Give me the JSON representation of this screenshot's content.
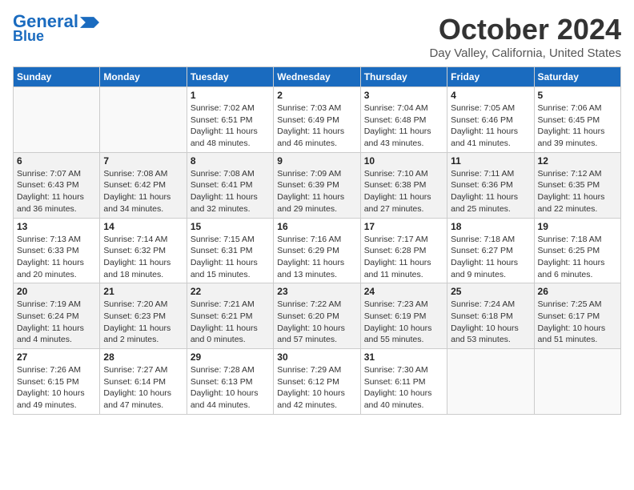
{
  "header": {
    "logo_line1": "General",
    "logo_line2": "Blue",
    "month": "October 2024",
    "location": "Day Valley, California, United States"
  },
  "weekdays": [
    "Sunday",
    "Monday",
    "Tuesday",
    "Wednesday",
    "Thursday",
    "Friday",
    "Saturday"
  ],
  "weeks": [
    [
      {
        "day": null,
        "info": null
      },
      {
        "day": null,
        "info": null
      },
      {
        "day": "1",
        "info": "Sunrise: 7:02 AM\nSunset: 6:51 PM\nDaylight: 11 hours and 48 minutes."
      },
      {
        "day": "2",
        "info": "Sunrise: 7:03 AM\nSunset: 6:49 PM\nDaylight: 11 hours and 46 minutes."
      },
      {
        "day": "3",
        "info": "Sunrise: 7:04 AM\nSunset: 6:48 PM\nDaylight: 11 hours and 43 minutes."
      },
      {
        "day": "4",
        "info": "Sunrise: 7:05 AM\nSunset: 6:46 PM\nDaylight: 11 hours and 41 minutes."
      },
      {
        "day": "5",
        "info": "Sunrise: 7:06 AM\nSunset: 6:45 PM\nDaylight: 11 hours and 39 minutes."
      }
    ],
    [
      {
        "day": "6",
        "info": "Sunrise: 7:07 AM\nSunset: 6:43 PM\nDaylight: 11 hours and 36 minutes."
      },
      {
        "day": "7",
        "info": "Sunrise: 7:08 AM\nSunset: 6:42 PM\nDaylight: 11 hours and 34 minutes."
      },
      {
        "day": "8",
        "info": "Sunrise: 7:08 AM\nSunset: 6:41 PM\nDaylight: 11 hours and 32 minutes."
      },
      {
        "day": "9",
        "info": "Sunrise: 7:09 AM\nSunset: 6:39 PM\nDaylight: 11 hours and 29 minutes."
      },
      {
        "day": "10",
        "info": "Sunrise: 7:10 AM\nSunset: 6:38 PM\nDaylight: 11 hours and 27 minutes."
      },
      {
        "day": "11",
        "info": "Sunrise: 7:11 AM\nSunset: 6:36 PM\nDaylight: 11 hours and 25 minutes."
      },
      {
        "day": "12",
        "info": "Sunrise: 7:12 AM\nSunset: 6:35 PM\nDaylight: 11 hours and 22 minutes."
      }
    ],
    [
      {
        "day": "13",
        "info": "Sunrise: 7:13 AM\nSunset: 6:33 PM\nDaylight: 11 hours and 20 minutes."
      },
      {
        "day": "14",
        "info": "Sunrise: 7:14 AM\nSunset: 6:32 PM\nDaylight: 11 hours and 18 minutes."
      },
      {
        "day": "15",
        "info": "Sunrise: 7:15 AM\nSunset: 6:31 PM\nDaylight: 11 hours and 15 minutes."
      },
      {
        "day": "16",
        "info": "Sunrise: 7:16 AM\nSunset: 6:29 PM\nDaylight: 11 hours and 13 minutes."
      },
      {
        "day": "17",
        "info": "Sunrise: 7:17 AM\nSunset: 6:28 PM\nDaylight: 11 hours and 11 minutes."
      },
      {
        "day": "18",
        "info": "Sunrise: 7:18 AM\nSunset: 6:27 PM\nDaylight: 11 hours and 9 minutes."
      },
      {
        "day": "19",
        "info": "Sunrise: 7:18 AM\nSunset: 6:25 PM\nDaylight: 11 hours and 6 minutes."
      }
    ],
    [
      {
        "day": "20",
        "info": "Sunrise: 7:19 AM\nSunset: 6:24 PM\nDaylight: 11 hours and 4 minutes."
      },
      {
        "day": "21",
        "info": "Sunrise: 7:20 AM\nSunset: 6:23 PM\nDaylight: 11 hours and 2 minutes."
      },
      {
        "day": "22",
        "info": "Sunrise: 7:21 AM\nSunset: 6:21 PM\nDaylight: 11 hours and 0 minutes."
      },
      {
        "day": "23",
        "info": "Sunrise: 7:22 AM\nSunset: 6:20 PM\nDaylight: 10 hours and 57 minutes."
      },
      {
        "day": "24",
        "info": "Sunrise: 7:23 AM\nSunset: 6:19 PM\nDaylight: 10 hours and 55 minutes."
      },
      {
        "day": "25",
        "info": "Sunrise: 7:24 AM\nSunset: 6:18 PM\nDaylight: 10 hours and 53 minutes."
      },
      {
        "day": "26",
        "info": "Sunrise: 7:25 AM\nSunset: 6:17 PM\nDaylight: 10 hours and 51 minutes."
      }
    ],
    [
      {
        "day": "27",
        "info": "Sunrise: 7:26 AM\nSunset: 6:15 PM\nDaylight: 10 hours and 49 minutes."
      },
      {
        "day": "28",
        "info": "Sunrise: 7:27 AM\nSunset: 6:14 PM\nDaylight: 10 hours and 47 minutes."
      },
      {
        "day": "29",
        "info": "Sunrise: 7:28 AM\nSunset: 6:13 PM\nDaylight: 10 hours and 44 minutes."
      },
      {
        "day": "30",
        "info": "Sunrise: 7:29 AM\nSunset: 6:12 PM\nDaylight: 10 hours and 42 minutes."
      },
      {
        "day": "31",
        "info": "Sunrise: 7:30 AM\nSunset: 6:11 PM\nDaylight: 10 hours and 40 minutes."
      },
      {
        "day": null,
        "info": null
      },
      {
        "day": null,
        "info": null
      }
    ]
  ]
}
